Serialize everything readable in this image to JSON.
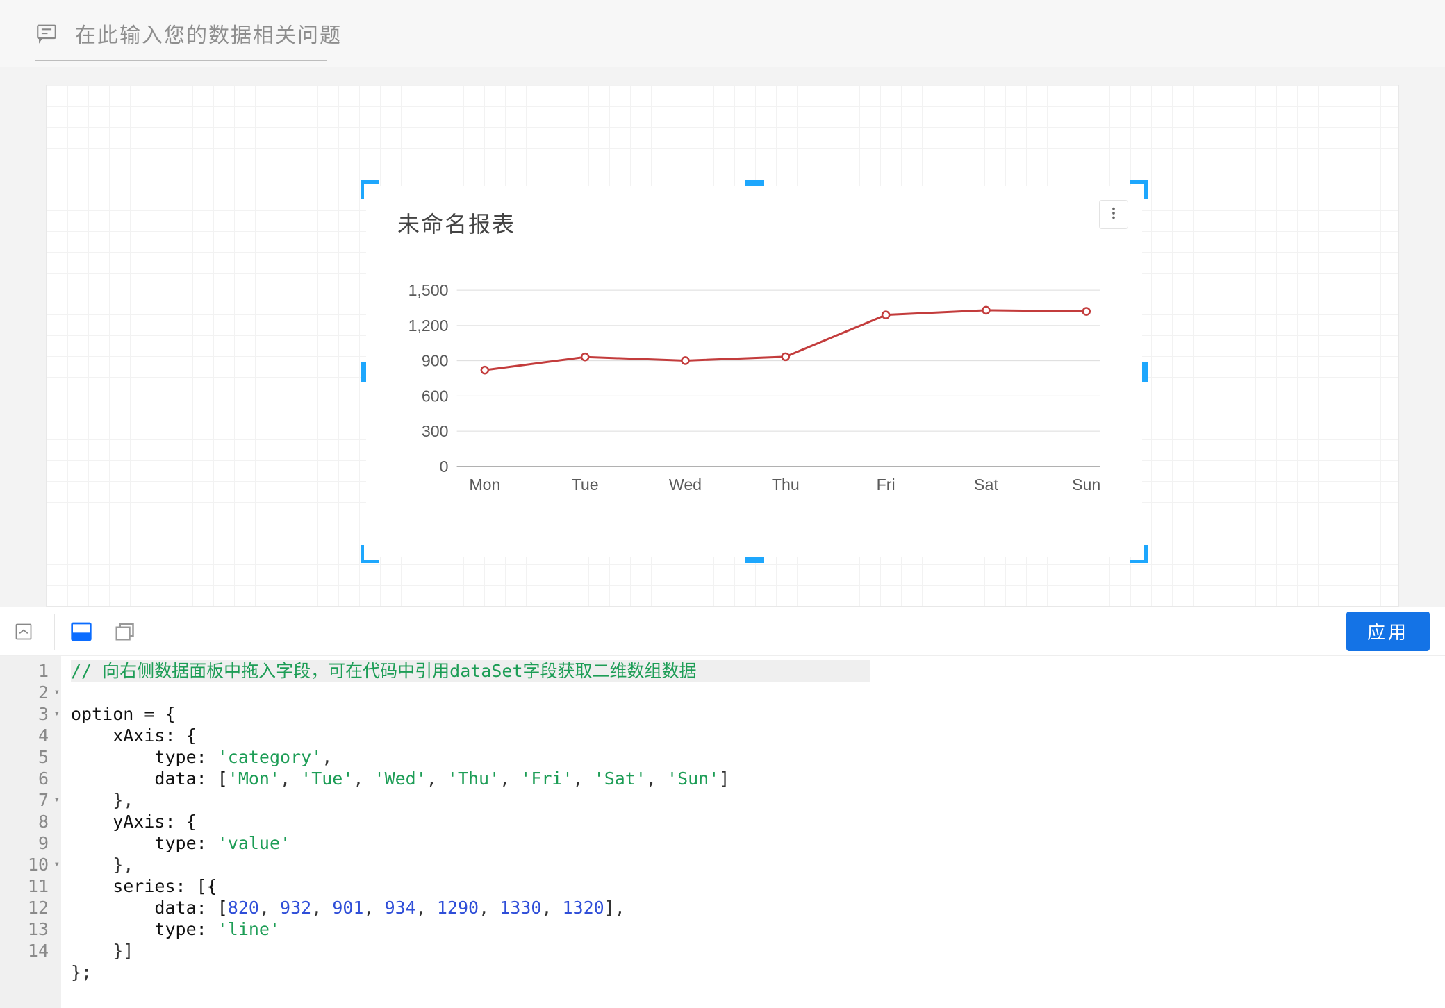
{
  "search": {
    "placeholder": "在此输入您的数据相关问题"
  },
  "chart_card": {
    "title": "未命名报表"
  },
  "toolbar": {
    "apply_label": "应用"
  },
  "chart_data": {
    "type": "line",
    "categories": [
      "Mon",
      "Tue",
      "Wed",
      "Thu",
      "Fri",
      "Sat",
      "Sun"
    ],
    "values": [
      820,
      932,
      901,
      934,
      1290,
      1330,
      1320
    ],
    "y_ticks": [
      0,
      300,
      600,
      900,
      1200,
      1500
    ],
    "ylim": [
      0,
      1500
    ],
    "series_color": "#c33c3c"
  },
  "code": {
    "comment": "// 向右侧数据面板中拖入字段，可在代码中引用dataSet字段获取二维数组数据",
    "l2": "option = {",
    "l3": "    xAxis: {",
    "l4a": "        type: ",
    "l4b": "'category'",
    "l4c": ",",
    "l5a": "        data: [",
    "l5b": "'Mon'",
    "l5c": "'Tue'",
    "l5d": "'Wed'",
    "l5e": "'Thu'",
    "l5f": "'Fri'",
    "l5g": "'Sat'",
    "l5h": "'Sun'",
    "l5z": "]",
    "l6": "    },",
    "l7": "    yAxis: {",
    "l8a": "        type: ",
    "l8b": "'value'",
    "l9": "    },",
    "l10": "    series: [{",
    "l11a": "        data: [",
    "l11z": "],",
    "l11n": [
      "820",
      "932",
      "901",
      "934",
      "1290",
      "1330",
      "1320"
    ],
    "l12a": "        type: ",
    "l12b": "'line'",
    "l13": "    }]",
    "l14": "};",
    "line_numbers": [
      "1",
      "2",
      "3",
      "4",
      "5",
      "6",
      "7",
      "8",
      "9",
      "10",
      "11",
      "12",
      "13",
      "14"
    ]
  }
}
